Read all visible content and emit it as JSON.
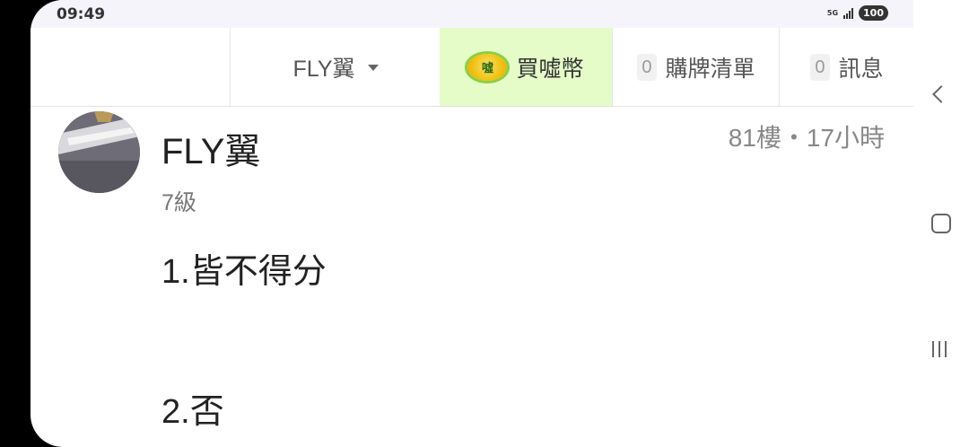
{
  "status_bar": {
    "time": "09:49",
    "network": "5G",
    "battery": "100"
  },
  "nav": {
    "user_label": "FLY翼",
    "coin_logo_text": "噓",
    "coin_label": "買噓幣",
    "cart_count": "0",
    "cart_label": "購牌清單",
    "msg_count": "0",
    "msg_label": "訊息"
  },
  "post": {
    "username": "FLY翼",
    "level": "7級",
    "meta": "81樓・17小時",
    "lines": [
      "1.皆不得分",
      "2.否"
    ]
  },
  "colors": {
    "coin_bg": "#e5fbc8",
    "text": "#222222",
    "muted": "#888888"
  }
}
